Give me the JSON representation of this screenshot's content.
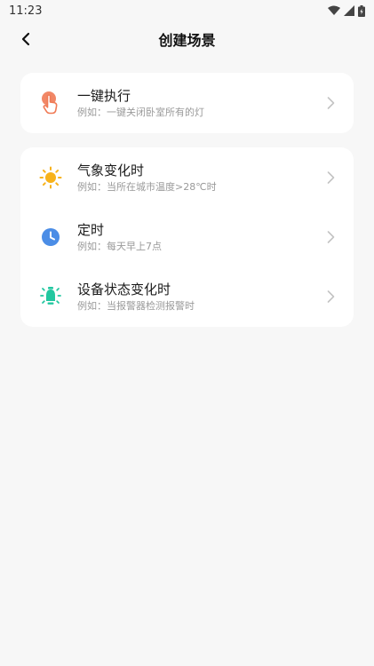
{
  "status_bar": {
    "time": "11:23"
  },
  "header": {
    "title": "创建场景"
  },
  "quick": {
    "items": [
      {
        "title": "一键执行",
        "subtitle": "例如：一键关闭卧室所有的灯",
        "icon": "tap-hand-icon",
        "color": "#f07a55"
      }
    ]
  },
  "conditions": {
    "items": [
      {
        "title": "气象变化时",
        "subtitle": "例如：当所在城市温度>28℃时",
        "icon": "sun-icon",
        "color": "#f7b21b"
      },
      {
        "title": "定时",
        "subtitle": "例如：每天早上7点",
        "icon": "clock-icon",
        "color": "#4b8de6"
      },
      {
        "title": "设备状态变化时",
        "subtitle": "例如：当报警器检测报警时",
        "icon": "bulb-icon",
        "color": "#22c7a0"
      }
    ]
  }
}
